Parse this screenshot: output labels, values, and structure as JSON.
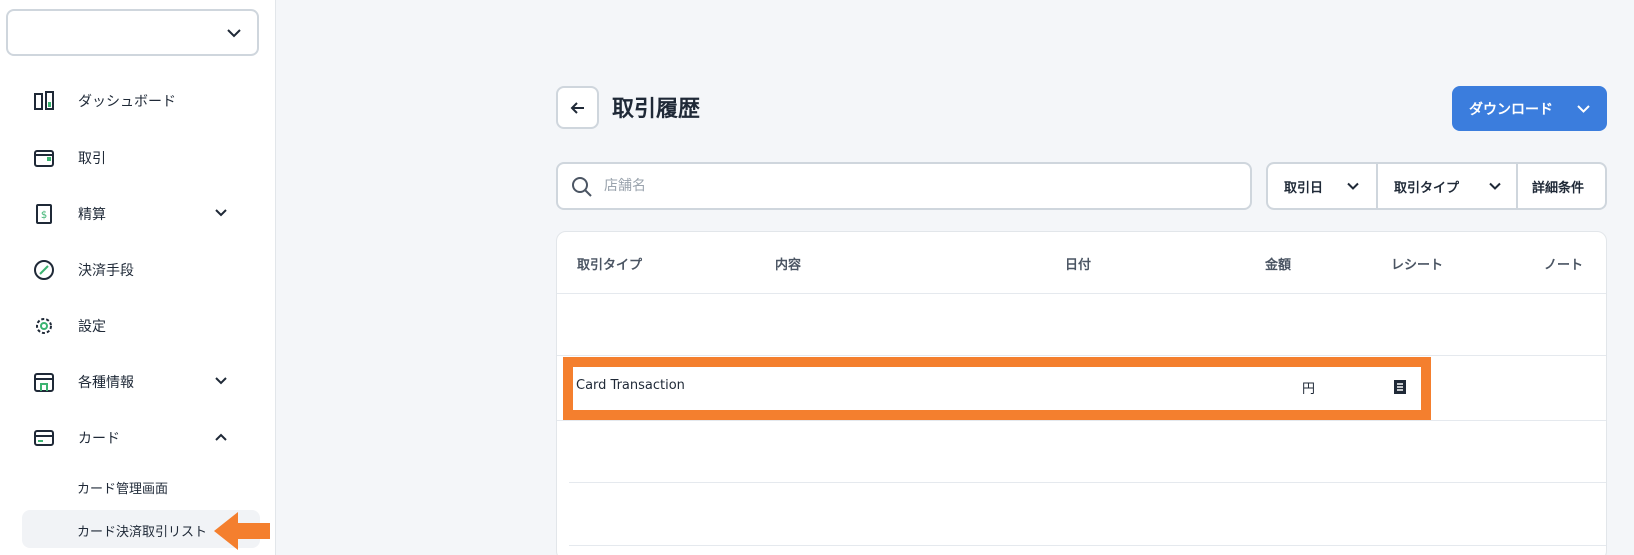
{
  "sidebar": {
    "org_select_value": "",
    "items": [
      {
        "label": "ダッシュボード",
        "icon": "dashboard-icon"
      },
      {
        "label": "取引",
        "icon": "wallet-icon"
      },
      {
        "label": "精算",
        "icon": "receipt-dollar-icon"
      },
      {
        "label": "決済手段",
        "icon": "payment-method-icon"
      },
      {
        "label": "設定",
        "icon": "gear-icon"
      },
      {
        "label": "各種情報",
        "icon": "info-store-icon"
      },
      {
        "label": "カード",
        "icon": "card-icon"
      }
    ],
    "sub_items": [
      {
        "label": "カード管理画面",
        "active": false
      },
      {
        "label": "カード決済取引リスト",
        "active": true
      }
    ]
  },
  "header": {
    "title": "取引履歴",
    "download_label": "ダウンロード"
  },
  "search": {
    "placeholder": "店舗名",
    "value": ""
  },
  "filters": {
    "date_label": "取引日",
    "type_label": "取引タイプ",
    "detail_label": "詳細条件"
  },
  "table": {
    "columns": [
      "取引タイプ",
      "内容",
      "日付",
      "金額",
      "レシート",
      "ノート"
    ],
    "rows": [
      {
        "type": "Card Transaction",
        "description": "",
        "date": "",
        "amount_unit": "円",
        "receipt_icon": "receipt-icon",
        "note": ""
      }
    ]
  },
  "colors": {
    "accent": "#3b7ddd",
    "highlight": "#f47f2e"
  }
}
